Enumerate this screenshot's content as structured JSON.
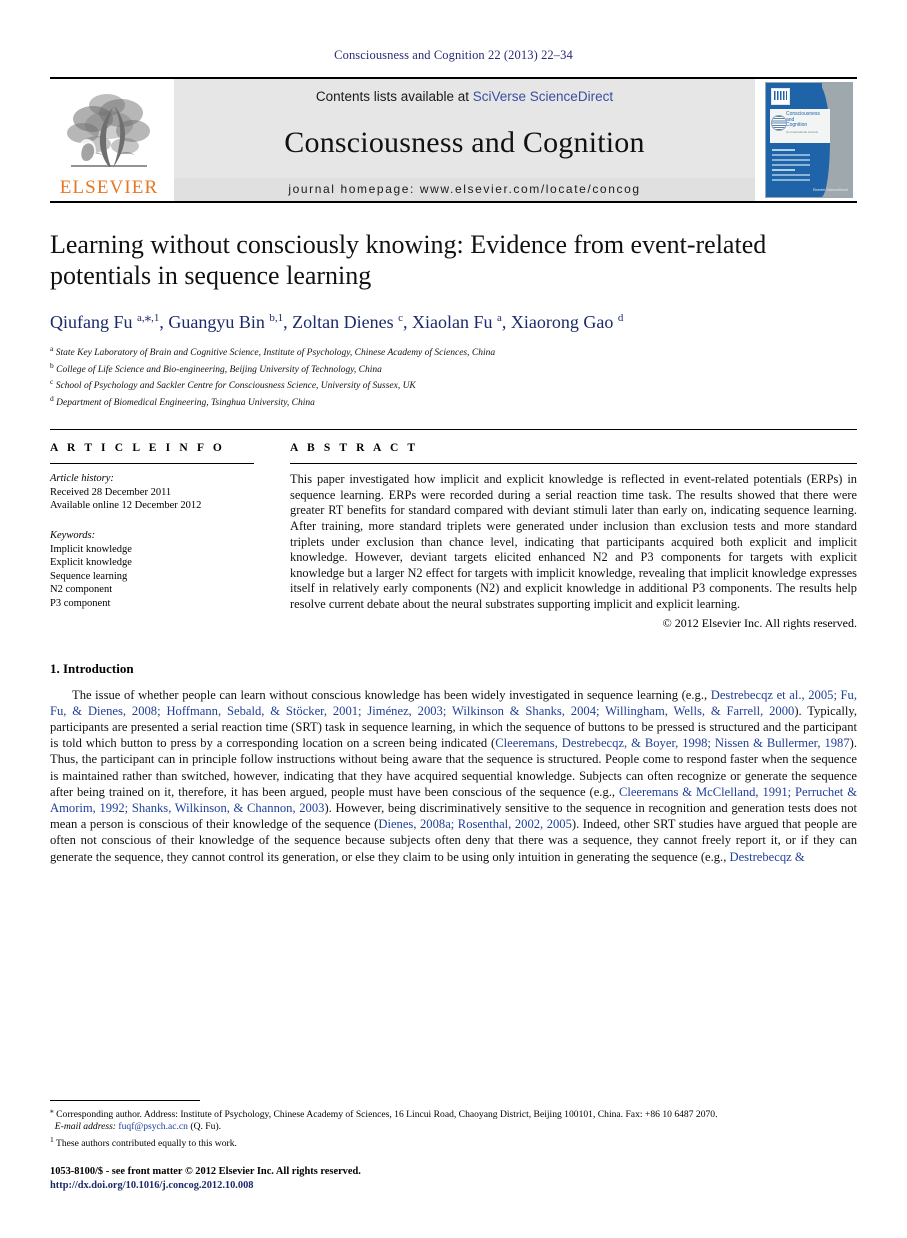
{
  "running_head": "Consciousness and Cognition 22 (2013) 22–34",
  "banner": {
    "contents_prefix": "Contents lists available at ",
    "contents_link": "SciVerse ScienceDirect",
    "journal_name": "Consciousness and Cognition",
    "homepage": "journal homepage: www.elsevier.com/locate/concog",
    "publisher_logo_text": "ELSEVIER",
    "cover": {
      "title_line1": "Consciousness",
      "title_line2": "and",
      "title_line3": "Cognition",
      "subtitle": "An International Journal",
      "footer": "Elsevier ScienceDirect"
    }
  },
  "article": {
    "title": "Learning without consciously knowing: Evidence from event-related potentials in sequence learning",
    "authors_html": "Qiufang Fu <sup>a,<span style=\"font-size:13px\">⁎</span>,1</sup>, Guangyu Bin <sup>b,1</sup>, Zoltan Dienes <sup>c</sup>, Xiaolan Fu <sup>a</sup>, Xiaorong Gao <sup>d</sup>",
    "affiliations": [
      {
        "marker": "a",
        "text": "State Key Laboratory of Brain and Cognitive Science, Institute of Psychology, Chinese Academy of Sciences, China"
      },
      {
        "marker": "b",
        "text": "College of Life Science and Bio-engineering, Beijing University of Technology, China"
      },
      {
        "marker": "c",
        "text": "School of Psychology and Sackler Centre for Consciousness Science, University of Sussex, UK"
      },
      {
        "marker": "d",
        "text": "Department of Biomedical Engineering, Tsinghua University, China"
      }
    ]
  },
  "article_info": {
    "heading": "A R T I C L E    I N F O",
    "history_label": "Article history:",
    "history": [
      "Received 28 December 2011",
      "Available online 12 December 2012"
    ],
    "keywords_label": "Keywords:",
    "keywords": [
      "Implicit knowledge",
      "Explicit knowledge",
      "Sequence learning",
      "N2 component",
      "P3 component"
    ]
  },
  "abstract": {
    "heading": "A B S T R A C T",
    "text": "This paper investigated how implicit and explicit knowledge is reflected in event-related potentials (ERPs) in sequence learning. ERPs were recorded during a serial reaction time task. The results showed that there were greater RT benefits for standard compared with deviant stimuli later than early on, indicating sequence learning. After training, more standard triplets were generated under inclusion than exclusion tests and more standard triplets under exclusion than chance level, indicating that participants acquired both explicit and implicit knowledge. However, deviant targets elicited enhanced N2 and P3 components for targets with explicit knowledge but a larger N2 effect for targets with implicit knowledge, revealing that implicit knowledge expresses itself in relatively early components (N2) and explicit knowledge in additional P3 components. The results help resolve current debate about the neural substrates supporting implicit and explicit learning.",
    "copyright": "© 2012 Elsevier Inc. All rights reserved."
  },
  "introduction": {
    "heading": "1. Introduction",
    "paragraph_html": "The issue of whether people can learn without conscious knowledge has been widely investigated in sequence learning (e.g., <span class=\"cite\">Destrebecqz et al., 2005; Fu, Fu, &amp; Dienes, 2008; Hoffmann, Sebald, &amp; Stöcker, 2001; Jiménez, 2003; Wilkinson &amp; Shanks, 2004; Willingham, Wells, &amp; Farrell, 2000</span>). Typically, participants are presented a serial reaction time (SRT) task in sequence learning, in which the sequence of buttons to be pressed is structured and the participant is told which button to press by a corresponding location on a screen being indicated (<span class=\"cite\">Cleeremans, Destrebecqz, &amp; Boyer, 1998; Nissen &amp; Bullermer, 1987</span>). Thus, the participant can in principle follow instructions without being aware that the sequence is structured. People come to respond faster when the sequence is maintained rather than switched, however, indicating that they have acquired sequential knowledge. Subjects can often recognize or generate the sequence after being trained on it, therefore, it has been argued, people must have been conscious of the sequence (e.g., <span class=\"cite\">Cleeremans &amp; McClelland, 1991; Perruchet &amp; Amorim, 1992; Shanks, Wilkinson, &amp; Channon, 2003</span>). However, being discriminatively sensitive to the sequence in recognition and generation tests does not mean a person is conscious of their knowledge of the sequence (<span class=\"cite\">Dienes, 2008a; Rosenthal, 2002, 2005</span>). Indeed, other SRT studies have argued that people are often not conscious of their knowledge of the sequence because subjects often deny that there was a sequence, they cannot freely report it, or if they can generate the sequence, they cannot control its generation, or else they claim to be using only intuition in generating the sequence (e.g., <span class=\"cite\">Destrebecqz &amp;</span>"
  },
  "footnotes": {
    "corresponding_html": "<sup>⁎</sup> Corresponding author. Address: Institute of Psychology, Chinese Academy of Sciences, 16 Lincui Road, Chaoyang District, Beijing 100101, China. Fax: +86 10 6487 2070.",
    "email_label": "E-mail address:",
    "email": "fuqf@psych.ac.cn",
    "email_suffix": "(Q. Fu).",
    "equal_contribution_html": "<sup>1</sup> These authors contributed equally to this work."
  },
  "imprint": {
    "line1": "1053-8100/$ - see front matter © 2012 Elsevier Inc. All rights reserved.",
    "doi": "http://dx.doi.org/10.1016/j.concog.2012.10.008"
  },
  "colors": {
    "running_head": "#2a2a7a",
    "link": "#3b4ea0",
    "citation": "#1f3f99",
    "author": "#1b2a6b",
    "elsevier_orange": "#E87722",
    "banner_bg": "#e6e6e6",
    "cover_blue": "#1f63a8"
  }
}
